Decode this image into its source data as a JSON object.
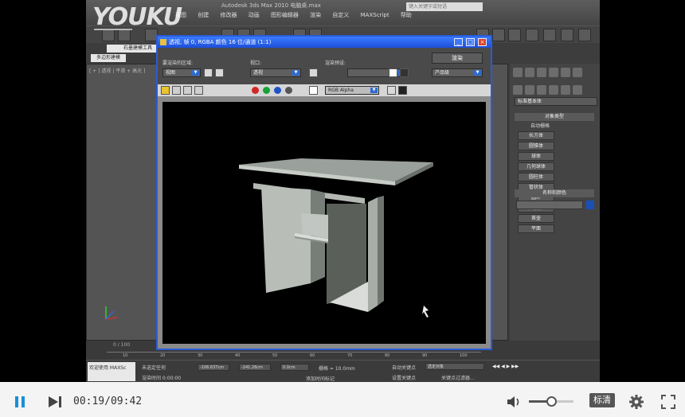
{
  "watermark": {
    "logo_text": "YOUKU"
  },
  "max_app": {
    "title": "Autodesk 3ds Max 2010  电脑桌.max",
    "search_placeholder": "键入关键字或短语",
    "menus": [
      "视图",
      "创建",
      "修改器",
      "动画",
      "图形编辑器",
      "渲染",
      "自定义",
      "MAXScript",
      "帮助"
    ],
    "ribbon_tab": "石墨建模工具",
    "ribbon_sub": "多边形建模",
    "viewport_label": "[ + ] 透视 | 平滑 + 高光 ]",
    "command_panel": {
      "dropdown": "标准基本体",
      "object_type_title": "对象类型",
      "autogrid": "自动栅格",
      "objects": [
        "长方体",
        "圆锥体",
        "球体",
        "几何球体",
        "圆柱体",
        "管状体",
        "圆环",
        "四棱锥",
        "茶壶",
        "平面"
      ],
      "name_color_title": "名称和颜色"
    },
    "trackbar": {
      "frame": "0 / 100",
      "ticks": [
        "10",
        "20",
        "30",
        "40",
        "50",
        "60",
        "70",
        "80",
        "90",
        "100"
      ]
    },
    "statusbar": {
      "welcome": "欢迎使用 MAXSc",
      "selection": "未选定任何",
      "render_time": "渲染时间 0:00:00",
      "x_value": "-106.637cm",
      "y_value": "-241.26cm",
      "z_value": "0.0cm",
      "grid": "栅格 = 10.0mm",
      "add_time_tag": "添加时间标记",
      "auto_key": "自动关键点",
      "set_key": "设置关键点",
      "selected": "选定对象",
      "key_filters": "关键点过滤器..."
    }
  },
  "render_window": {
    "title": "透视, 帧 0, RGBA 颜色 16 位/通道 (1:1)",
    "area_label": "要渲染的区域:",
    "area_value": "视图",
    "viewport_label": "视口:",
    "viewport_value": "透视",
    "preset_label": "渲染预设:",
    "preset_value": "",
    "render_button": "渲染",
    "product_value": "产品级",
    "channel_value": "RGB Alpha"
  },
  "player": {
    "current_time": "00:19",
    "duration": "09:42",
    "time_display": "00:19/09:42",
    "progress_fraction": 0.0326,
    "volume_fraction": 0.5,
    "quality_label": "标清",
    "colors": {
      "progress": "#e3262b",
      "play_button": "#1a8fd8"
    },
    "icons": [
      "pause-icon",
      "next-icon",
      "volume-icon",
      "settings-icon",
      "fullscreen-icon"
    ]
  }
}
